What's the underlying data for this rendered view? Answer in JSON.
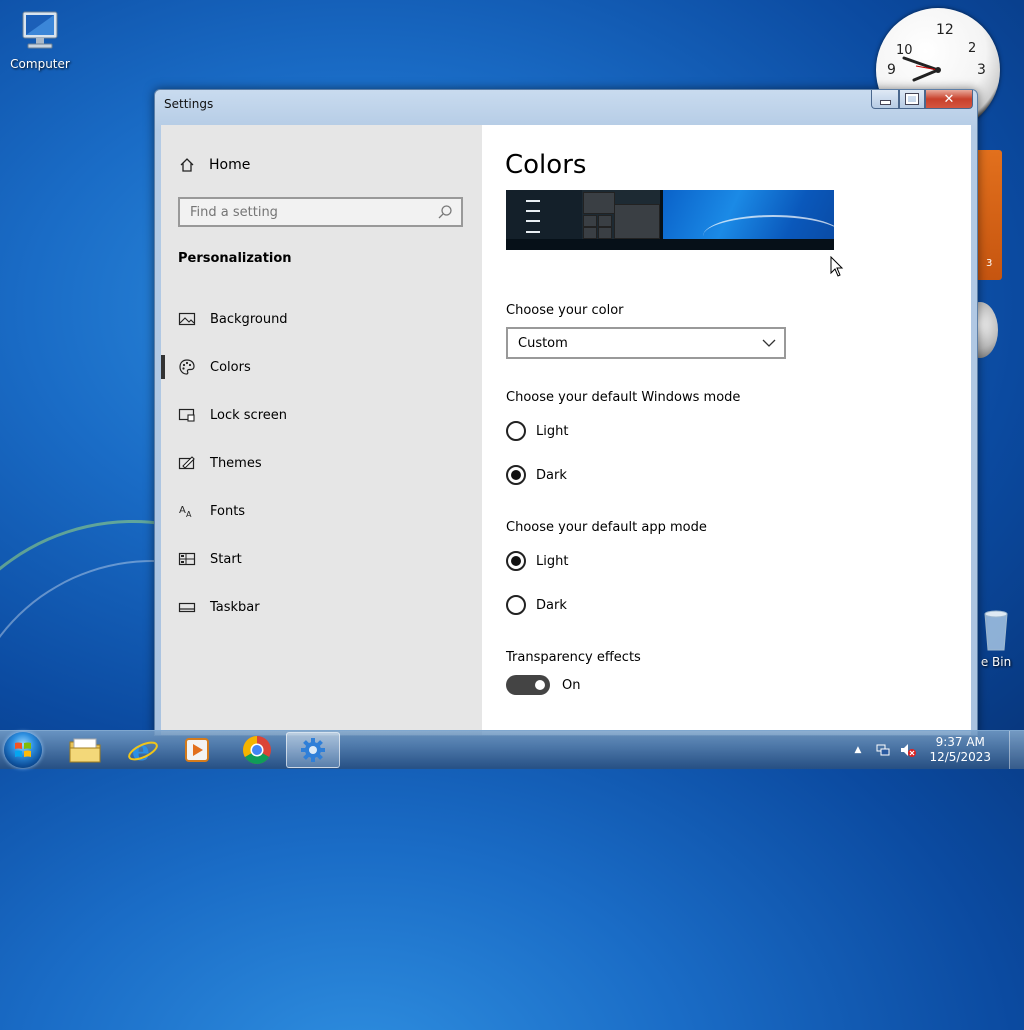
{
  "desktop": {
    "computer_label": "Computer",
    "bin_label": "e Bin",
    "calendar_digit": "3"
  },
  "window": {
    "title": "Settings"
  },
  "sidebar": {
    "home_label": "Home",
    "search_placeholder": "Find a setting",
    "section_title": "Personalization",
    "items": [
      {
        "label": "Background",
        "icon": "picture-icon"
      },
      {
        "label": "Colors",
        "icon": "palette-icon",
        "selected": true
      },
      {
        "label": "Lock screen",
        "icon": "lock-screen-icon"
      },
      {
        "label": "Themes",
        "icon": "paintbrush-icon"
      },
      {
        "label": "Fonts",
        "icon": "font-icon"
      },
      {
        "label": "Start",
        "icon": "start-icon"
      },
      {
        "label": "Taskbar",
        "icon": "taskbar-icon"
      }
    ]
  },
  "main": {
    "page_title": "Colors",
    "choose_color_label": "Choose your color",
    "choose_color_value": "Custom",
    "windows_mode_label": "Choose your default Windows mode",
    "windows_mode_options": [
      {
        "label": "Light",
        "checked": false
      },
      {
        "label": "Dark",
        "checked": true
      }
    ],
    "app_mode_label": "Choose your default app mode",
    "app_mode_options": [
      {
        "label": "Light",
        "checked": true
      },
      {
        "label": "Dark",
        "checked": false
      }
    ],
    "transparency_label": "Transparency effects",
    "transparency_value": "On"
  },
  "taskbar": {
    "apps": [
      "file-explorer-icon",
      "internet-explorer-icon",
      "media-player-icon",
      "chrome-icon",
      "settings-icon"
    ],
    "time": "9:37 AM",
    "date": "12/5/2023"
  }
}
